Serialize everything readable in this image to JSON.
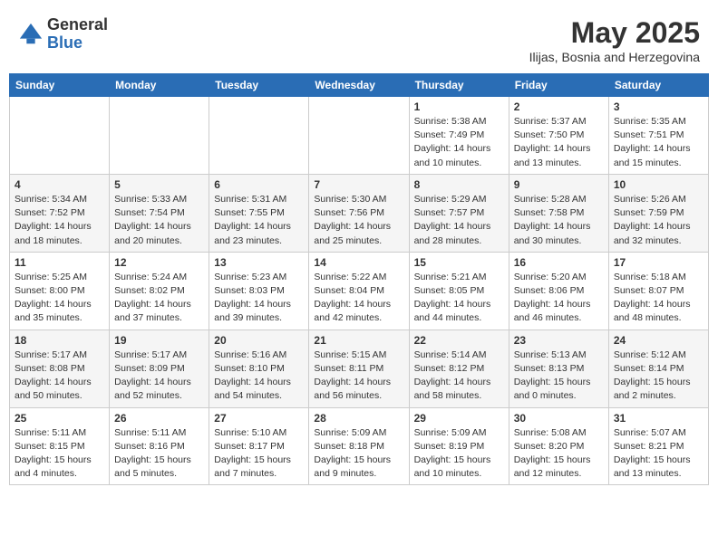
{
  "logo": {
    "general": "General",
    "blue": "Blue"
  },
  "header": {
    "month_year": "May 2025",
    "location": "Ilijas, Bosnia and Herzegovina"
  },
  "weekdays": [
    "Sunday",
    "Monday",
    "Tuesday",
    "Wednesday",
    "Thursday",
    "Friday",
    "Saturday"
  ],
  "weeks": [
    [
      {
        "day": "",
        "info": ""
      },
      {
        "day": "",
        "info": ""
      },
      {
        "day": "",
        "info": ""
      },
      {
        "day": "",
        "info": ""
      },
      {
        "day": "1",
        "info": "Sunrise: 5:38 AM\nSunset: 7:49 PM\nDaylight: 14 hours\nand 10 minutes."
      },
      {
        "day": "2",
        "info": "Sunrise: 5:37 AM\nSunset: 7:50 PM\nDaylight: 14 hours\nand 13 minutes."
      },
      {
        "day": "3",
        "info": "Sunrise: 5:35 AM\nSunset: 7:51 PM\nDaylight: 14 hours\nand 15 minutes."
      }
    ],
    [
      {
        "day": "4",
        "info": "Sunrise: 5:34 AM\nSunset: 7:52 PM\nDaylight: 14 hours\nand 18 minutes."
      },
      {
        "day": "5",
        "info": "Sunrise: 5:33 AM\nSunset: 7:54 PM\nDaylight: 14 hours\nand 20 minutes."
      },
      {
        "day": "6",
        "info": "Sunrise: 5:31 AM\nSunset: 7:55 PM\nDaylight: 14 hours\nand 23 minutes."
      },
      {
        "day": "7",
        "info": "Sunrise: 5:30 AM\nSunset: 7:56 PM\nDaylight: 14 hours\nand 25 minutes."
      },
      {
        "day": "8",
        "info": "Sunrise: 5:29 AM\nSunset: 7:57 PM\nDaylight: 14 hours\nand 28 minutes."
      },
      {
        "day": "9",
        "info": "Sunrise: 5:28 AM\nSunset: 7:58 PM\nDaylight: 14 hours\nand 30 minutes."
      },
      {
        "day": "10",
        "info": "Sunrise: 5:26 AM\nSunset: 7:59 PM\nDaylight: 14 hours\nand 32 minutes."
      }
    ],
    [
      {
        "day": "11",
        "info": "Sunrise: 5:25 AM\nSunset: 8:00 PM\nDaylight: 14 hours\nand 35 minutes."
      },
      {
        "day": "12",
        "info": "Sunrise: 5:24 AM\nSunset: 8:02 PM\nDaylight: 14 hours\nand 37 minutes."
      },
      {
        "day": "13",
        "info": "Sunrise: 5:23 AM\nSunset: 8:03 PM\nDaylight: 14 hours\nand 39 minutes."
      },
      {
        "day": "14",
        "info": "Sunrise: 5:22 AM\nSunset: 8:04 PM\nDaylight: 14 hours\nand 42 minutes."
      },
      {
        "day": "15",
        "info": "Sunrise: 5:21 AM\nSunset: 8:05 PM\nDaylight: 14 hours\nand 44 minutes."
      },
      {
        "day": "16",
        "info": "Sunrise: 5:20 AM\nSunset: 8:06 PM\nDaylight: 14 hours\nand 46 minutes."
      },
      {
        "day": "17",
        "info": "Sunrise: 5:18 AM\nSunset: 8:07 PM\nDaylight: 14 hours\nand 48 minutes."
      }
    ],
    [
      {
        "day": "18",
        "info": "Sunrise: 5:17 AM\nSunset: 8:08 PM\nDaylight: 14 hours\nand 50 minutes."
      },
      {
        "day": "19",
        "info": "Sunrise: 5:17 AM\nSunset: 8:09 PM\nDaylight: 14 hours\nand 52 minutes."
      },
      {
        "day": "20",
        "info": "Sunrise: 5:16 AM\nSunset: 8:10 PM\nDaylight: 14 hours\nand 54 minutes."
      },
      {
        "day": "21",
        "info": "Sunrise: 5:15 AM\nSunset: 8:11 PM\nDaylight: 14 hours\nand 56 minutes."
      },
      {
        "day": "22",
        "info": "Sunrise: 5:14 AM\nSunset: 8:12 PM\nDaylight: 14 hours\nand 58 minutes."
      },
      {
        "day": "23",
        "info": "Sunrise: 5:13 AM\nSunset: 8:13 PM\nDaylight: 15 hours\nand 0 minutes."
      },
      {
        "day": "24",
        "info": "Sunrise: 5:12 AM\nSunset: 8:14 PM\nDaylight: 15 hours\nand 2 minutes."
      }
    ],
    [
      {
        "day": "25",
        "info": "Sunrise: 5:11 AM\nSunset: 8:15 PM\nDaylight: 15 hours\nand 4 minutes."
      },
      {
        "day": "26",
        "info": "Sunrise: 5:11 AM\nSunset: 8:16 PM\nDaylight: 15 hours\nand 5 minutes."
      },
      {
        "day": "27",
        "info": "Sunrise: 5:10 AM\nSunset: 8:17 PM\nDaylight: 15 hours\nand 7 minutes."
      },
      {
        "day": "28",
        "info": "Sunrise: 5:09 AM\nSunset: 8:18 PM\nDaylight: 15 hours\nand 9 minutes."
      },
      {
        "day": "29",
        "info": "Sunrise: 5:09 AM\nSunset: 8:19 PM\nDaylight: 15 hours\nand 10 minutes."
      },
      {
        "day": "30",
        "info": "Sunrise: 5:08 AM\nSunset: 8:20 PM\nDaylight: 15 hours\nand 12 minutes."
      },
      {
        "day": "31",
        "info": "Sunrise: 5:07 AM\nSunset: 8:21 PM\nDaylight: 15 hours\nand 13 minutes."
      }
    ]
  ]
}
